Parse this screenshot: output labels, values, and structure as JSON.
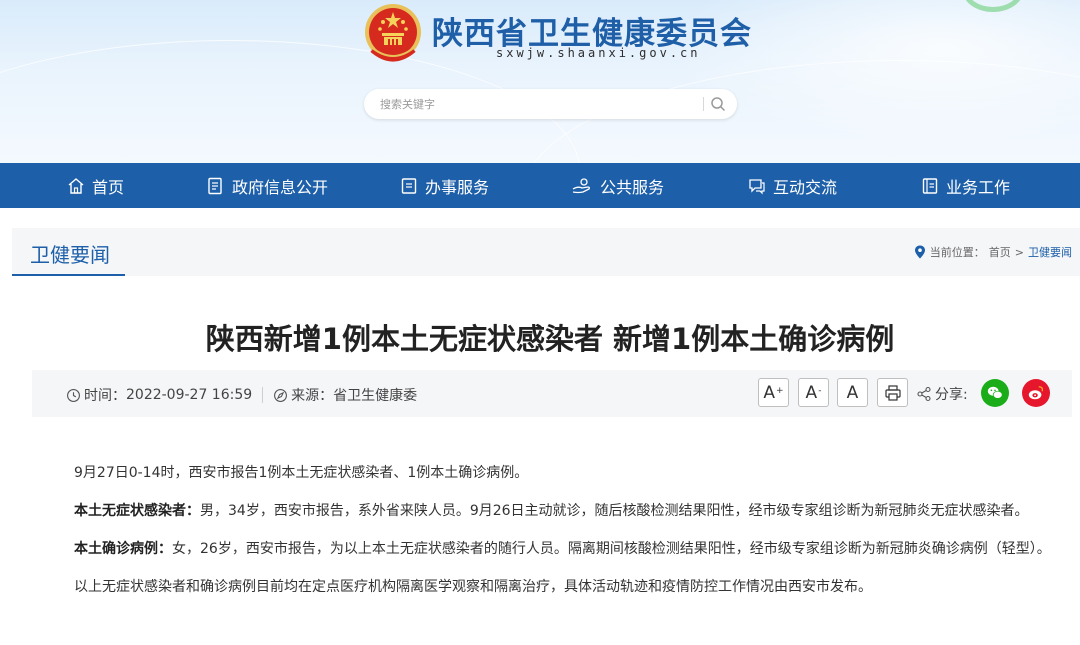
{
  "header": {
    "site_title": "陕西省卫生健康委员会",
    "site_url": "sxwjw.shaanxi.gov.cn",
    "emblem_icon": "national-emblem-icon",
    "search_placeholder": "搜索关键字",
    "search_icon": "search-icon"
  },
  "nav": {
    "items": [
      {
        "label": "首页",
        "icon": "home-icon"
      },
      {
        "label": "政府信息公开",
        "icon": "document-list-icon"
      },
      {
        "label": "办事服务",
        "icon": "clipboard-icon"
      },
      {
        "label": "公共服务",
        "icon": "service-hand-icon"
      },
      {
        "label": "互动交流",
        "icon": "chat-bubble-icon"
      },
      {
        "label": "业务工作",
        "icon": "book-icon"
      }
    ]
  },
  "section": {
    "title": "卫健要闻",
    "breadcrumb_label": "当前位置：",
    "breadcrumb_home": "首页",
    "breadcrumb_sep": ">",
    "breadcrumb_current": "卫健要闻"
  },
  "article": {
    "title": "陕西新增1例本土无症状感染者 新增1例本土确诊病例",
    "time_label": "时间：",
    "time_value": "2022-09-27 16:59",
    "source_label": "来源：",
    "source_value": "省卫生健康委",
    "font_increase": "A",
    "font_increase_sup": "+",
    "font_decrease": "A",
    "font_decrease_sup": "-",
    "font_default": "A",
    "share_label": "分享:",
    "paragraphs": [
      {
        "bold": "",
        "text": "9月27日0-14时，西安市报告1例本土无症状感染者、1例本土确诊病例。"
      },
      {
        "bold": "本土无症状感染者：",
        "text": "男，34岁，西安市报告，系外省来陕人员。9月26日主动就诊，随后核酸检测结果阳性，经市级专家组诊断为新冠肺炎无症状感染者。"
      },
      {
        "bold": "本土确诊病例：",
        "text": "女，26岁，西安市报告，为以上本土无症状感染者的随行人员。隔离期间核酸检测结果阳性，经市级专家组诊断为新冠肺炎确诊病例（轻型）。"
      },
      {
        "bold": "",
        "text": "以上无症状感染者和确诊病例目前均在定点医疗机构隔离医学观察和隔离治疗，具体活动轨迹和疫情防控工作情况由西安市发布。"
      }
    ]
  },
  "colors": {
    "brand_blue": "#1d5fa8",
    "wechat_green": "#1aad19",
    "weibo_red": "#e6162d"
  }
}
